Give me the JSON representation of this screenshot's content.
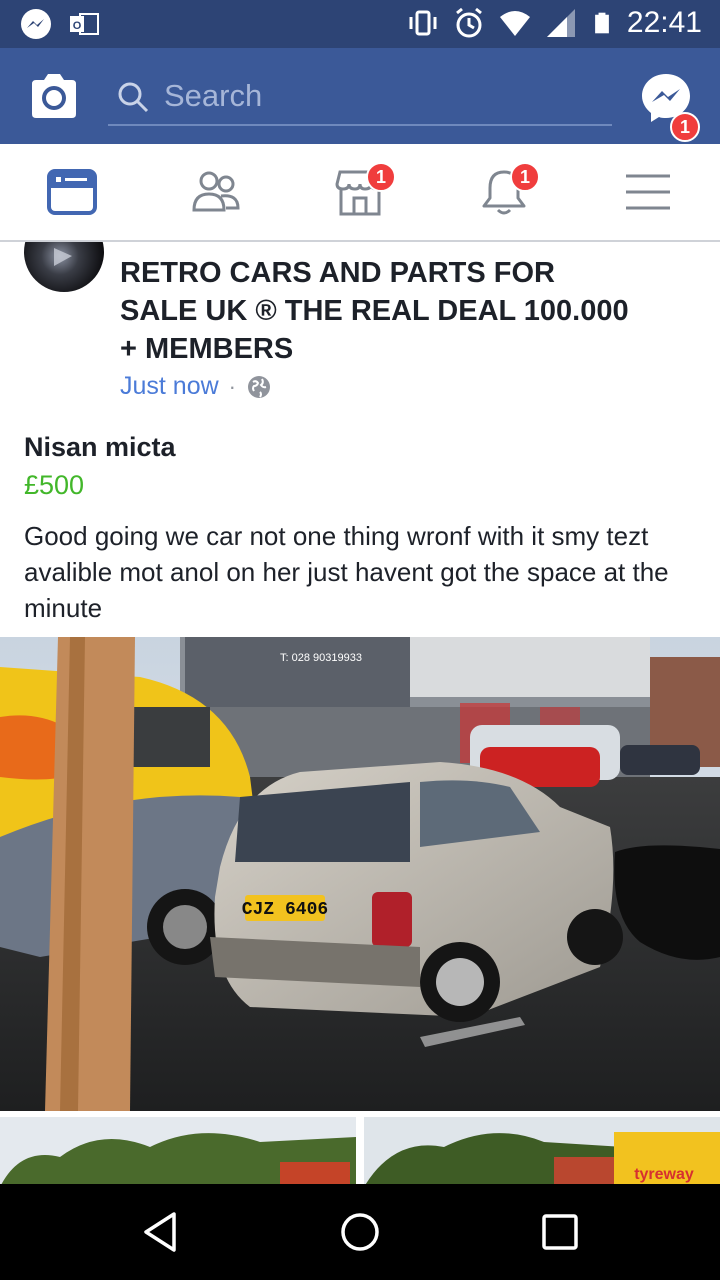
{
  "status_bar": {
    "time": "22:41",
    "left_icons": [
      "messenger-icon",
      "outlook-icon"
    ],
    "right_icons": [
      "vibrate-icon",
      "alarm-icon",
      "wifi-icon",
      "signal-icon",
      "battery-icon"
    ]
  },
  "header": {
    "search_placeholder": "Search",
    "messenger_badge": "1"
  },
  "nav": {
    "tabs": [
      {
        "name": "news-feed",
        "icon": "news-feed-icon",
        "badge": ""
      },
      {
        "name": "friends",
        "icon": "friends-icon",
        "badge": ""
      },
      {
        "name": "marketplace",
        "icon": "marketplace-icon",
        "badge": "1"
      },
      {
        "name": "notifications",
        "icon": "bell-icon",
        "badge": "1"
      },
      {
        "name": "menu",
        "icon": "hamburger-menu-icon",
        "badge": ""
      }
    ],
    "accent": "#3b5998"
  },
  "post": {
    "group_name": "RETRO CARS AND PARTS FOR SALE UK ® THE REAL DEAL 100.000 + MEMBERS",
    "timestamp": "Just now",
    "separator": "·",
    "privacy_icon": "globe-icon",
    "item_title": "Nisan micta",
    "item_price": "£500",
    "description": "Good going we car not one thing wronf with it smy tezt avalible mot anol on her just havent got the space at the minute",
    "photo": {
      "sign_phone": "T: 028 90319933",
      "plate": "CJZ 6406",
      "thumb_text": "tyreway"
    },
    "price_color": "#42b72a",
    "link_color": "#4b7bd8"
  },
  "android_nav": {
    "buttons": [
      "back-icon",
      "home-icon",
      "recents-icon"
    ]
  }
}
